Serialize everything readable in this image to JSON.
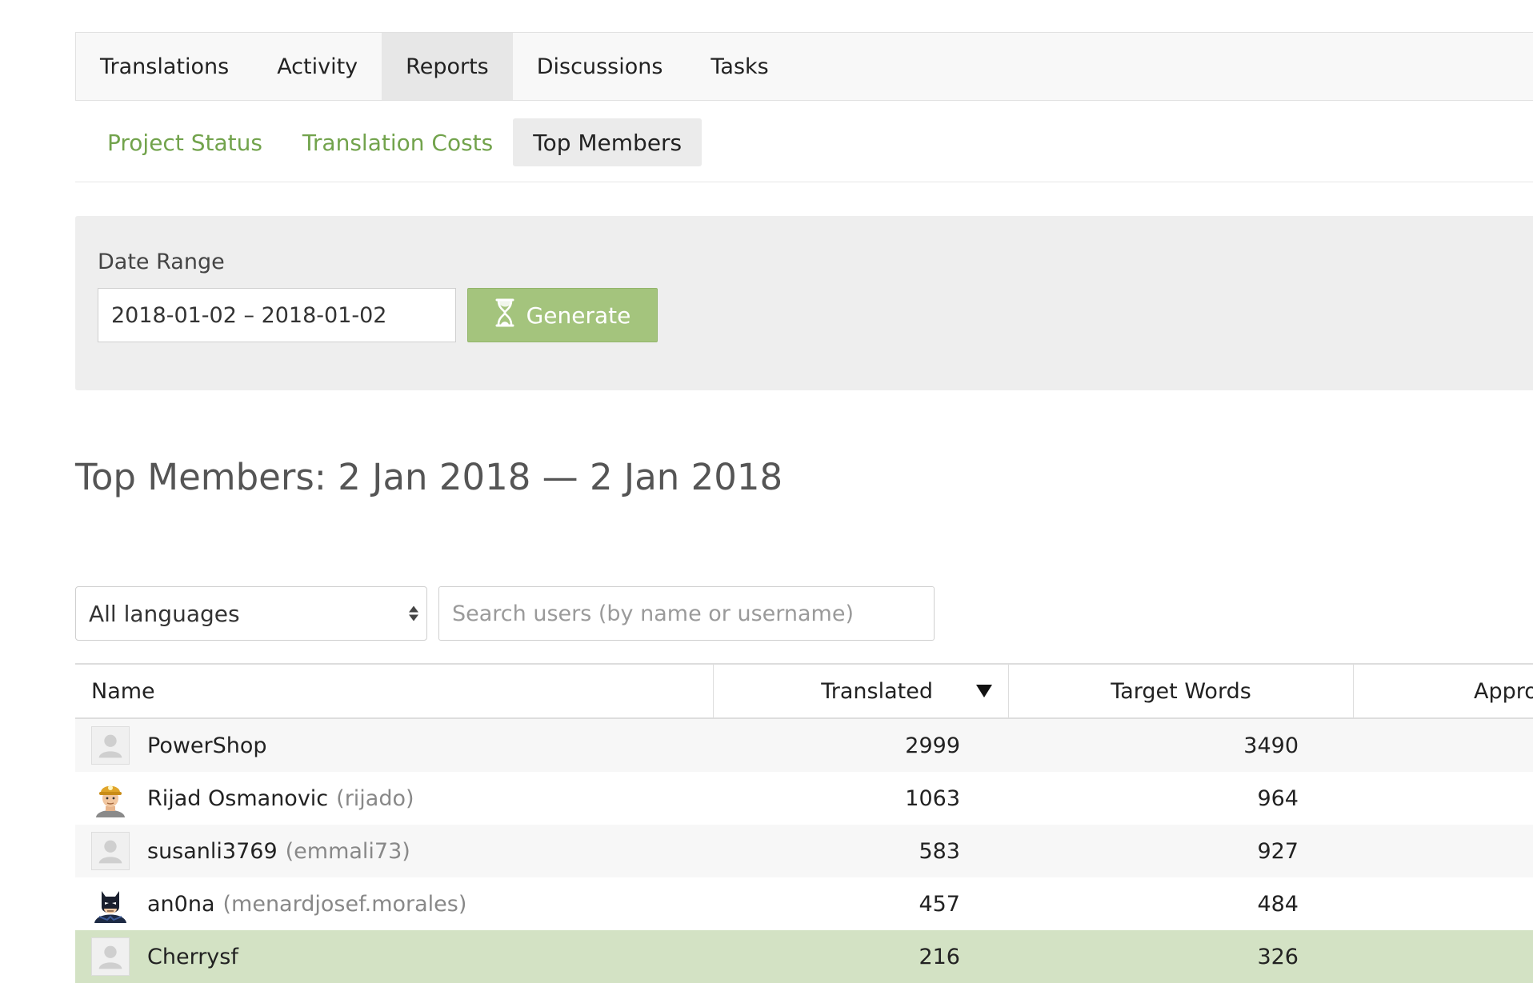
{
  "top_nav": {
    "tabs": [
      {
        "label": "Translations",
        "active": false
      },
      {
        "label": "Activity",
        "active": false
      },
      {
        "label": "Reports",
        "active": true
      },
      {
        "label": "Discussions",
        "active": false
      },
      {
        "label": "Tasks",
        "active": false
      }
    ]
  },
  "sub_nav": {
    "tabs": [
      {
        "label": "Project Status",
        "active": false
      },
      {
        "label": "Translation Costs",
        "active": false
      },
      {
        "label": "Top Members",
        "active": true
      }
    ]
  },
  "date_range": {
    "label": "Date Range",
    "value": "2018-01-02 – 2018-01-02",
    "generate_label": "Generate"
  },
  "page": {
    "title": "Top Members: 2 Jan 2018 — 2 Jan 2018"
  },
  "filters": {
    "language_selected": "All languages",
    "search_placeholder": "Search users (by name or username)"
  },
  "table": {
    "headers": {
      "name": "Name",
      "translated": "Translated",
      "target_words": "Target Words",
      "approved": "Appro"
    },
    "rows": [
      {
        "name": "PowerShop",
        "username": "",
        "avatar": "default-avatar-icon",
        "translated": "2999",
        "target_words": "3490",
        "highlight": false
      },
      {
        "name": "Rijad Osmanovic",
        "username": "(rijado)",
        "avatar": "miner-avatar-icon",
        "translated": "1063",
        "target_words": "964",
        "highlight": false
      },
      {
        "name": "susanli3769",
        "username": "(emmali73)",
        "avatar": "default-avatar-icon",
        "translated": "583",
        "target_words": "927",
        "highlight": false
      },
      {
        "name": "an0na",
        "username": "(menardjosef.morales)",
        "avatar": "batman-avatar-icon",
        "translated": "457",
        "target_words": "484",
        "highlight": false
      },
      {
        "name": "Cherrysf",
        "username": "",
        "avatar": "default-avatar-icon",
        "translated": "216",
        "target_words": "326",
        "highlight": true
      }
    ]
  },
  "colors": {
    "accent_green": "#72a34c",
    "button_green": "#a4c47d",
    "highlight_row": "#d3e2c4"
  }
}
